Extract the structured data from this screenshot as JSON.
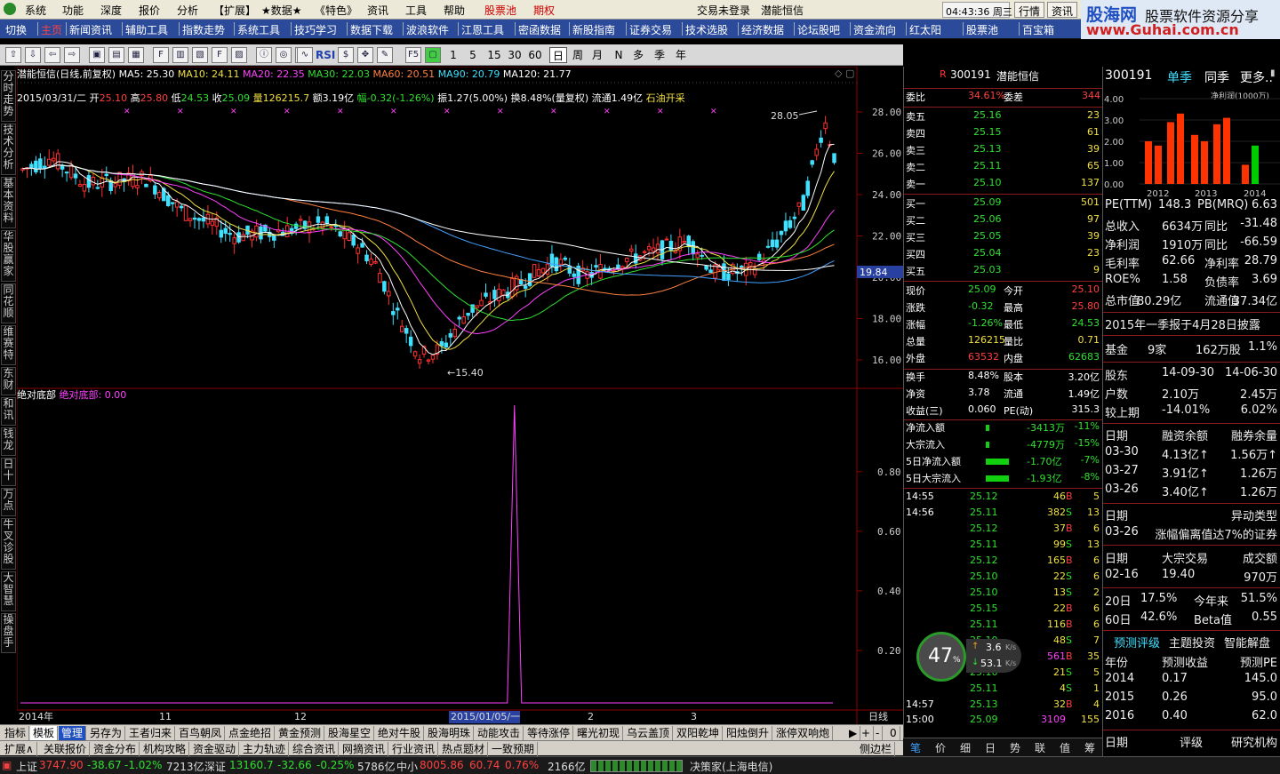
{
  "menu": {
    "items": [
      "系统",
      "功能",
      "深度",
      "报价",
      "分析",
      "【扩展】",
      "★数据★",
      "《特色》",
      "资讯",
      "工具",
      "帮助",
      "股票池",
      "期权"
    ],
    "login": "交易未登录",
    "stock_title": "潜能恒信",
    "time": "04:43:36",
    "weekday": "周三",
    "btn_quote": "行情",
    "btn_news": "资讯"
  },
  "logo": {
    "brand": "股海网",
    "slogan": "股票软件资源分享",
    "url": "www.Guhai.com.cn"
  },
  "nav": {
    "items": [
      "切换",
      "主页",
      "新闻资讯",
      "辅助工具",
      "指数走势",
      "系统工具",
      "技巧学习",
      "数据下载",
      "波浪软件",
      "江恩工具",
      "密函数据",
      "新股指南",
      "证券交易",
      "技术选股",
      "经济数据",
      "论坛股吧",
      "资金流向",
      "红太阳",
      "股票池",
      "百宝箱"
    ]
  },
  "toolbar": {
    "periods": [
      "1",
      "5",
      "15",
      "30",
      "60",
      "日",
      "周",
      "月",
      "N",
      "多",
      "季",
      "年"
    ],
    "rsi": "RSI"
  },
  "vtabs": [
    "分时走势",
    "技术分析",
    "基本资料",
    "华股赢家",
    "同花顺",
    "维赛特",
    "东财",
    "和讯",
    "钱龙",
    "日十",
    "万点",
    "牛叉诊股",
    "大智慧",
    "操盘手"
  ],
  "kline": {
    "title": "潜能恒信(日线,前复权)",
    "ma5": "MA5: 25.30",
    "ma10": "MA10: 24.11",
    "ma20": "MA20: 22.35",
    "ma30": "MA30: 22.03",
    "ma60": "MA60: 20.51",
    "ma90": "MA90: 20.79",
    "ma120": "MA120: 21.77",
    "date": "2015/03/31/二",
    "open_l": "开",
    "open": "25.10",
    "high_l": "高",
    "high": "25.80",
    "low_l": "低",
    "low": "24.53",
    "close_l": "收",
    "close": "25.09",
    "vol_l": "量",
    "vol": "126215.7",
    "amt": "额3.19亿",
    "chg": "幅-0.32(-1.26%)",
    "amp": "振1.27(5.00%)",
    "turn": "换8.48%(量复权)",
    "float": "流通1.49亿",
    "concept": "石油开采",
    "yticks": [
      "28.00",
      "26.00",
      "24.00",
      "22.00",
      "20.00",
      "18.00",
      "16.00"
    ],
    "max_label": "28.05",
    "min_label": "15.40",
    "price_tag": "19.84",
    "xticks": [
      "2014年",
      "11",
      "12",
      "2015/01/05/一",
      "2",
      "3"
    ],
    "period_label": "日线"
  },
  "indicator": {
    "name": "绝对底部",
    "value_label": "绝对底部: 0.00",
    "yticks": [
      "0.80",
      "0.60",
      "0.40",
      "0.20"
    ]
  },
  "index_tabs": [
    "指标",
    "模板",
    "管理",
    "另存为",
    "王者归来",
    "百鸟朝凤",
    "点金绝招",
    "黄金预测",
    "股海星空",
    "绝对牛股",
    "股海明珠",
    "动能攻击",
    "等待涨停",
    "曙光初现",
    "乌云盖顶",
    "双阳乾坤",
    "阳烛倒升",
    "涨停双响炮"
  ],
  "index_tabs2": [
    "扩展∧",
    "关联报价",
    "资金分布",
    "机构攻略",
    "资金驱动",
    "主力轨迹",
    "综合资讯",
    "网摘资讯",
    "行业资讯",
    "热点题材",
    "一致预期"
  ],
  "side_label": "侧边栏",
  "status": {
    "sh_l": "上证",
    "sh": "3747.90",
    "sh_c": "-38.67",
    "sh_p": "-1.02%",
    "sh_a": "7213亿",
    "sz_l": "深证",
    "sz": "13160.7",
    "sz_c": "-32.66",
    "sz_p": "-0.25%",
    "sz_a": "5786亿",
    "zx_l": "中小",
    "zx": "8005.86",
    "zx_c": "60.74",
    "zx_p": "0.76%",
    "zx_a": "2166亿",
    "broker": "决策家(上海电信)"
  },
  "orderbook": {
    "code": "300191",
    "name": "潜能恒信",
    "wb_l": "委比",
    "wb": "34.61%",
    "wc_l": "委差",
    "wc": "344",
    "asks": [
      {
        "l": "卖五",
        "p": "25.16",
        "v": "23"
      },
      {
        "l": "卖四",
        "p": "25.15",
        "v": "61"
      },
      {
        "l": "卖三",
        "p": "25.13",
        "v": "39"
      },
      {
        "l": "卖二",
        "p": "25.11",
        "v": "65"
      },
      {
        "l": "卖一",
        "p": "25.10",
        "v": "137"
      }
    ],
    "bids": [
      {
        "l": "买一",
        "p": "25.09",
        "v": "501"
      },
      {
        "l": "买二",
        "p": "25.06",
        "v": "97"
      },
      {
        "l": "买三",
        "p": "25.05",
        "v": "39"
      },
      {
        "l": "买四",
        "p": "25.04",
        "v": "23"
      },
      {
        "l": "买五",
        "p": "25.03",
        "v": "9"
      }
    ],
    "stats": [
      [
        "现价",
        "25.09",
        "今开",
        "25.10"
      ],
      [
        "涨跌",
        "-0.32",
        "最高",
        "25.80"
      ],
      [
        "涨幅",
        "-1.26%",
        "最低",
        "24.53"
      ],
      [
        "总量",
        "126215",
        "量比",
        "0.71"
      ],
      [
        "外盘",
        "63532",
        "内盘",
        "62683"
      ],
      [
        "换手",
        "8.48%",
        "股本",
        "3.20亿"
      ],
      [
        "净资",
        "3.78",
        "流通",
        "1.49亿"
      ],
      [
        "收益(三)",
        "0.060",
        "PE(动)",
        "315.3"
      ]
    ],
    "flows": [
      [
        "净流入额",
        "-3413万",
        "-11%"
      ],
      [
        "大宗流入",
        "-4779万",
        "-15%"
      ],
      [
        "5日净流入额",
        "-1.70亿",
        "-7%"
      ],
      [
        "5日大宗流入",
        "-1.93亿",
        "-8%"
      ]
    ],
    "ticks": [
      [
        "14:55",
        "25.12",
        "46",
        "B",
        "5"
      ],
      [
        "14:56",
        "25.11",
        "382",
        "S",
        "13"
      ],
      [
        "",
        "25.12",
        "37",
        "B",
        "6"
      ],
      [
        "",
        "25.11",
        "99",
        "S",
        "13"
      ],
      [
        "",
        "25.12",
        "165",
        "B",
        "6"
      ],
      [
        "",
        "25.10",
        "22",
        "S",
        "6"
      ],
      [
        "",
        "25.10",
        "13",
        "S",
        "2"
      ],
      [
        "",
        "25.15",
        "22",
        "B",
        "6"
      ],
      [
        "",
        "25.11",
        "116",
        "B",
        "6"
      ],
      [
        "",
        "25.10",
        "48",
        "S",
        "7"
      ],
      [
        "",
        "25.10",
        "561",
        "B",
        "35"
      ],
      [
        "",
        "25.10",
        "21",
        "S",
        "5"
      ],
      [
        "",
        "25.11",
        "4",
        "S",
        "1"
      ],
      [
        "14:57",
        "25.13",
        "32",
        "B",
        "4"
      ],
      [
        "15:00",
        "25.09",
        "3109",
        "",
        "155"
      ]
    ],
    "gauge": "47",
    "gauge_pct": "%",
    "up_speed": "3.6",
    "down_speed": "53.1",
    "speed_unit": "K/s",
    "tabs": [
      "笔",
      "价",
      "细",
      "日",
      "势",
      "联",
      "值",
      "筹"
    ]
  },
  "f10": {
    "code": "300191",
    "tab1": "单季",
    "tab2": "同季",
    "more": "更多..",
    "profit_label": "净利润(1000万)",
    "rows": [
      [
        "PE(TTM)",
        "148.3",
        "PB(MRQ)",
        "6.63"
      ],
      [
        "总收入",
        "6634万",
        "同比",
        "-31.48"
      ],
      [
        "净利润",
        "1910万",
        "同比",
        "-66.59"
      ],
      [
        "毛利率",
        "62.66",
        "净利率",
        "28.79"
      ],
      [
        "ROE%",
        "1.58",
        "负债率",
        "3.69"
      ],
      [
        "总市值",
        "80.29亿",
        "流通值",
        "37.34亿"
      ]
    ],
    "report": "2015年一季报于4月28日披露",
    "fund": [
      "基金",
      "9家",
      "162万股",
      "1.1%"
    ],
    "holders": [
      [
        "股东",
        "14-09-30",
        "14-06-30"
      ],
      [
        "户数",
        "2.10万",
        "2.45万"
      ],
      [
        "较上期",
        "-14.01%",
        "6.02%"
      ]
    ],
    "margin": [
      [
        "日期",
        "融资余额",
        "融券余量"
      ],
      [
        "03-30",
        "4.13亿↑",
        "1.56万↑"
      ],
      [
        "03-27",
        "3.91亿↑",
        "1.26万"
      ],
      [
        "03-26",
        "3.40亿↑",
        "1.26万"
      ]
    ],
    "abnormal": [
      [
        "日期",
        "异动类型"
      ],
      [
        "03-26",
        "涨幅偏离值达7%的证券"
      ]
    ],
    "block": [
      [
        "日期",
        "大宗交易",
        "成交额"
      ],
      [
        "02-16",
        "19.40",
        "970万"
      ]
    ],
    "beta": [
      [
        "20日",
        "17.5%",
        "今年来",
        "51.5%"
      ],
      [
        "60日",
        "42.6%",
        "Beta值",
        "0.55"
      ]
    ],
    "ftabs": [
      "预测评级",
      "主题投资",
      "智能解盘"
    ],
    "forecast": [
      [
        "年份",
        "预测收益",
        "预测PE"
      ],
      [
        "2014",
        "0.17",
        "145.0"
      ],
      [
        "2015",
        "0.26",
        "95.0"
      ],
      [
        "2016",
        "0.40",
        "62.0"
      ]
    ],
    "rating": [
      "日期",
      "评级",
      "研究机构"
    ]
  },
  "chart_data": {
    "type": "bar",
    "title": "净利润(1000万)",
    "categories": [
      "2012",
      "2013",
      "2014"
    ],
    "series": [
      {
        "values": [
          2.0,
          1.8,
          2.9,
          3.3,
          2.3,
          2.0,
          2.8,
          3.1,
          0.9,
          1.8
        ],
        "colors": [
          "#ff3300",
          "#ff3300",
          "#ff3300",
          "#ff3300",
          "#ff3300",
          "#ff3300",
          "#ff3300",
          "#ff3300",
          "#ff3300",
          "#00cc00"
        ]
      }
    ],
    "ylim": [
      0,
      4
    ],
    "yticks": [
      "4.00",
      "3.00",
      "2.00",
      "1.00",
      "0.00"
    ]
  }
}
